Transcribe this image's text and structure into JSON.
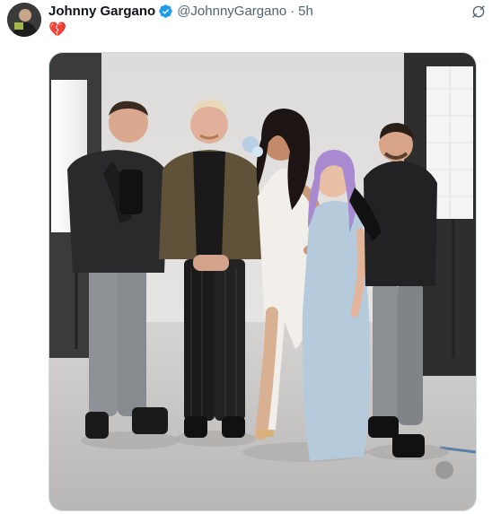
{
  "tweet": {
    "author": {
      "display_name": "Johnny Gargano",
      "handle": "@JohnnyGargano",
      "verified_icon": "verified-badge-icon",
      "avatar_icon": "profile-avatar"
    },
    "separator": "·",
    "timestamp": "5h",
    "text": "💔",
    "grok_icon": "grok-icon",
    "media_icon": "photo"
  },
  "colors": {
    "verified": "#1d9bf0",
    "secondary_text": "#536471",
    "primary_text": "#0f1419",
    "media_border": "#cfd9de"
  }
}
